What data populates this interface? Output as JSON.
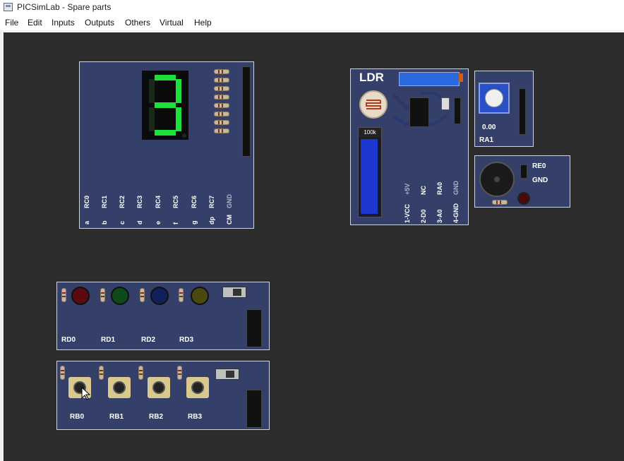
{
  "window": {
    "title": "PICSimLab - Spare parts",
    "icon": "app-window-icon"
  },
  "menu": {
    "items": [
      "File",
      "Edit",
      "Inputs",
      "Outputs",
      "Others",
      "Virtual",
      "Help"
    ]
  },
  "seven_segment": {
    "active_segments": [
      "a",
      "b",
      "c",
      "d",
      "g"
    ],
    "pins": [
      {
        "seg": "a",
        "port": "RC0"
      },
      {
        "seg": "b",
        "port": "RC1"
      },
      {
        "seg": "c",
        "port": "RC2"
      },
      {
        "seg": "d",
        "port": "RC3"
      },
      {
        "seg": "e",
        "port": "RC4"
      },
      {
        "seg": "f",
        "port": "RC5"
      },
      {
        "seg": "g",
        "port": "RC6"
      },
      {
        "seg": "dp",
        "port": "RC7"
      },
      {
        "seg": "CM",
        "port": "GND"
      }
    ]
  },
  "ldr": {
    "title": "LDR",
    "slider_label": "100k",
    "pins": [
      {
        "name": "1-VCC",
        "port": "+5V"
      },
      {
        "name": "2-D0",
        "port": "NC"
      },
      {
        "name": "3-A0",
        "port": "RA0"
      },
      {
        "name": "4-GND",
        "port": "GND"
      }
    ]
  },
  "potentiometer": {
    "value": "0.00",
    "pin": "RA1"
  },
  "buzzer": {
    "pin1": "RE0",
    "pin2": "GND"
  },
  "leds": {
    "items": [
      {
        "label": "RD0",
        "color": "#5a0a10"
      },
      {
        "label": "RD1",
        "color": "#0f4a1a"
      },
      {
        "label": "RD2",
        "color": "#10205a"
      },
      {
        "label": "RD3",
        "color": "#4a4a10"
      }
    ]
  },
  "buttons": {
    "items": [
      {
        "label": "RB0"
      },
      {
        "label": "RB1"
      },
      {
        "label": "RB2"
      },
      {
        "label": "RB3"
      }
    ]
  },
  "cursor": {
    "icon": "mouse-pointer-icon"
  }
}
